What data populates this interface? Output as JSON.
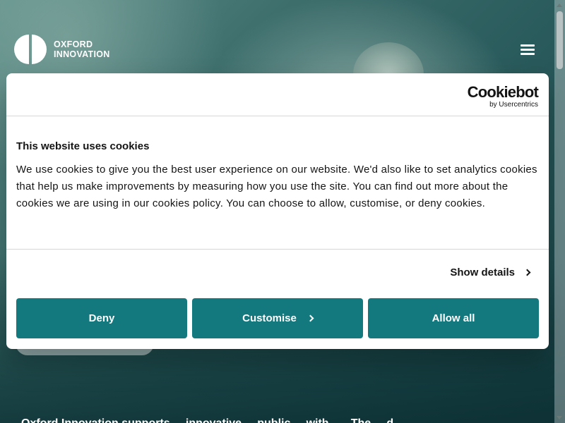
{
  "brand": {
    "logo_line1": "OXFORD",
    "logo_line2": "INNOVATION"
  },
  "header": {
    "menu_icon": "hamburger-menu-icon"
  },
  "cookie_dialog": {
    "provider_name": "Cookiebot",
    "provider_sub": "by Usercentrics",
    "title": "This website uses cookies",
    "body": "We use cookies to give you the best user experience on our website. We'd also like to set analytics cookies that help us make improvements by measuring how you use the site. You can find out more about the cookies we are using in our cookies policy. You can choose to allow, customise, or deny cookies.",
    "show_details_label": "Show details",
    "buttons": {
      "deny": "Deny",
      "customise": "Customise",
      "allow_all": "Allow all"
    },
    "accent_color": "#14797e"
  },
  "page": {
    "partial_text": "Oxford Innovation supports ... innovative ... public ... with ... . The ... d"
  }
}
